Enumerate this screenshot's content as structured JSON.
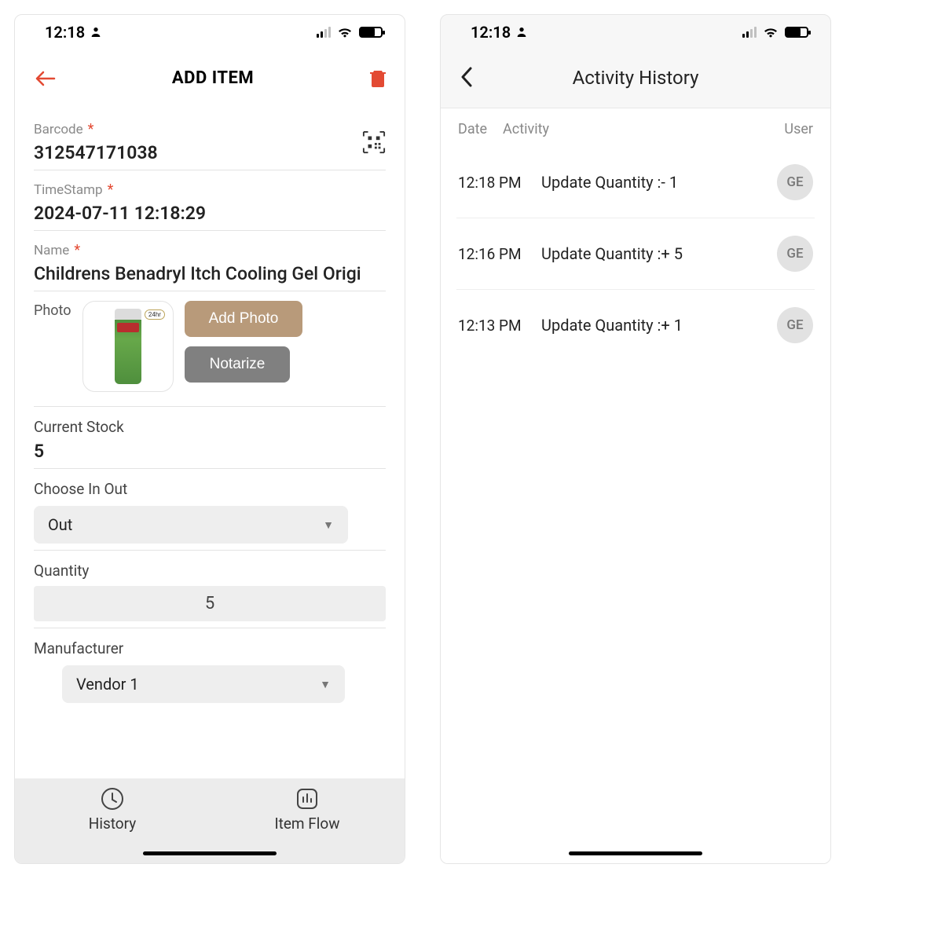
{
  "statusbar": {
    "time": "12:18"
  },
  "screen1": {
    "title": "ADD ITEM",
    "fields": {
      "barcode_label": "Barcode",
      "barcode_value": "312547171038",
      "timestamp_label": "TimeStamp",
      "timestamp_value": "2024-07-11 12:18:29",
      "name_label": "Name",
      "name_value": "Childrens Benadryl Itch Cooling Gel Origi",
      "photo_label": "Photo",
      "add_photo_label": "Add Photo",
      "notarize_label": "Notarize",
      "current_stock_label": "Current Stock",
      "current_stock_value": "5",
      "choose_in_out_label": "Choose In Out",
      "choose_in_out_value": "Out",
      "quantity_label": "Quantity",
      "quantity_value": "5",
      "manufacturer_label": "Manufacturer",
      "manufacturer_value": "Vendor 1"
    },
    "tabs": {
      "history": "History",
      "item_flow": "Item Flow"
    }
  },
  "screen2": {
    "title": "Activity History",
    "columns": {
      "date": "Date",
      "activity": "Activity",
      "user": "User"
    },
    "rows": [
      {
        "time": "12:18 PM",
        "activity": "Update Quantity :- 1",
        "user": "GE"
      },
      {
        "time": "12:16 PM",
        "activity": "Update Quantity :+ 5",
        "user": "GE"
      },
      {
        "time": "12:13 PM",
        "activity": "Update Quantity :+ 1",
        "user": "GE"
      }
    ]
  }
}
